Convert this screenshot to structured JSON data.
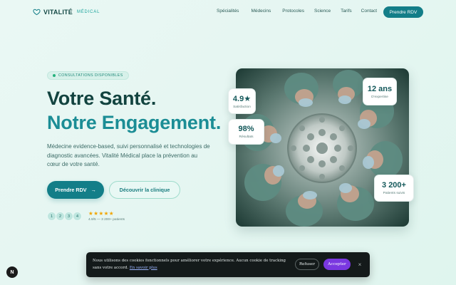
{
  "brand": {
    "name": "VITALITÉ",
    "sub": "MÉDICAL"
  },
  "nav": {
    "links": [
      "Spécialités",
      "Médecins",
      "Protocoles",
      "Science",
      "Tarifs",
      "Contact"
    ],
    "cta": "Prendre RDV"
  },
  "hero": {
    "badge": "CONSULTATIONS DISPONIBLES",
    "title_line1": "Votre Santé.",
    "title_line2": "Notre Engagement.",
    "lead": "Médecine evidence-based, suivi personnalisé et technologies de diagnostic avancées. Vitalité Médical place la prévention au cœur de votre santé.",
    "primary_button": "Prendre RDV",
    "primary_arrow": "→",
    "secondary_button": "Découvrir la clinique",
    "avatars": [
      "1",
      "2",
      "3",
      "4"
    ],
    "stars": "★★★★★",
    "rating_text": "4.9/5 — 3 200+ patients"
  },
  "stats": [
    {
      "value": "4.9★",
      "label": "Satisfaction"
    },
    {
      "value": "98%",
      "label": "Résultats"
    },
    {
      "value": "12 ans",
      "label": "D'expertise"
    },
    {
      "value": "3 200+",
      "label": "Patients suivis"
    }
  ],
  "cookie": {
    "text": "Nous utilisons des cookies fonctionnels pour améliorer votre expérience. Aucun cookie de tracking sans votre accord.",
    "link": "En savoir plus",
    "refuse": "Refuser",
    "accept": "Accepter",
    "close": "×"
  },
  "dev_badge": "N",
  "colors": {
    "primary": "#137e88",
    "accent_text": "#1b8d95",
    "dark_text": "#12433f",
    "accept": "#7a38e0"
  }
}
